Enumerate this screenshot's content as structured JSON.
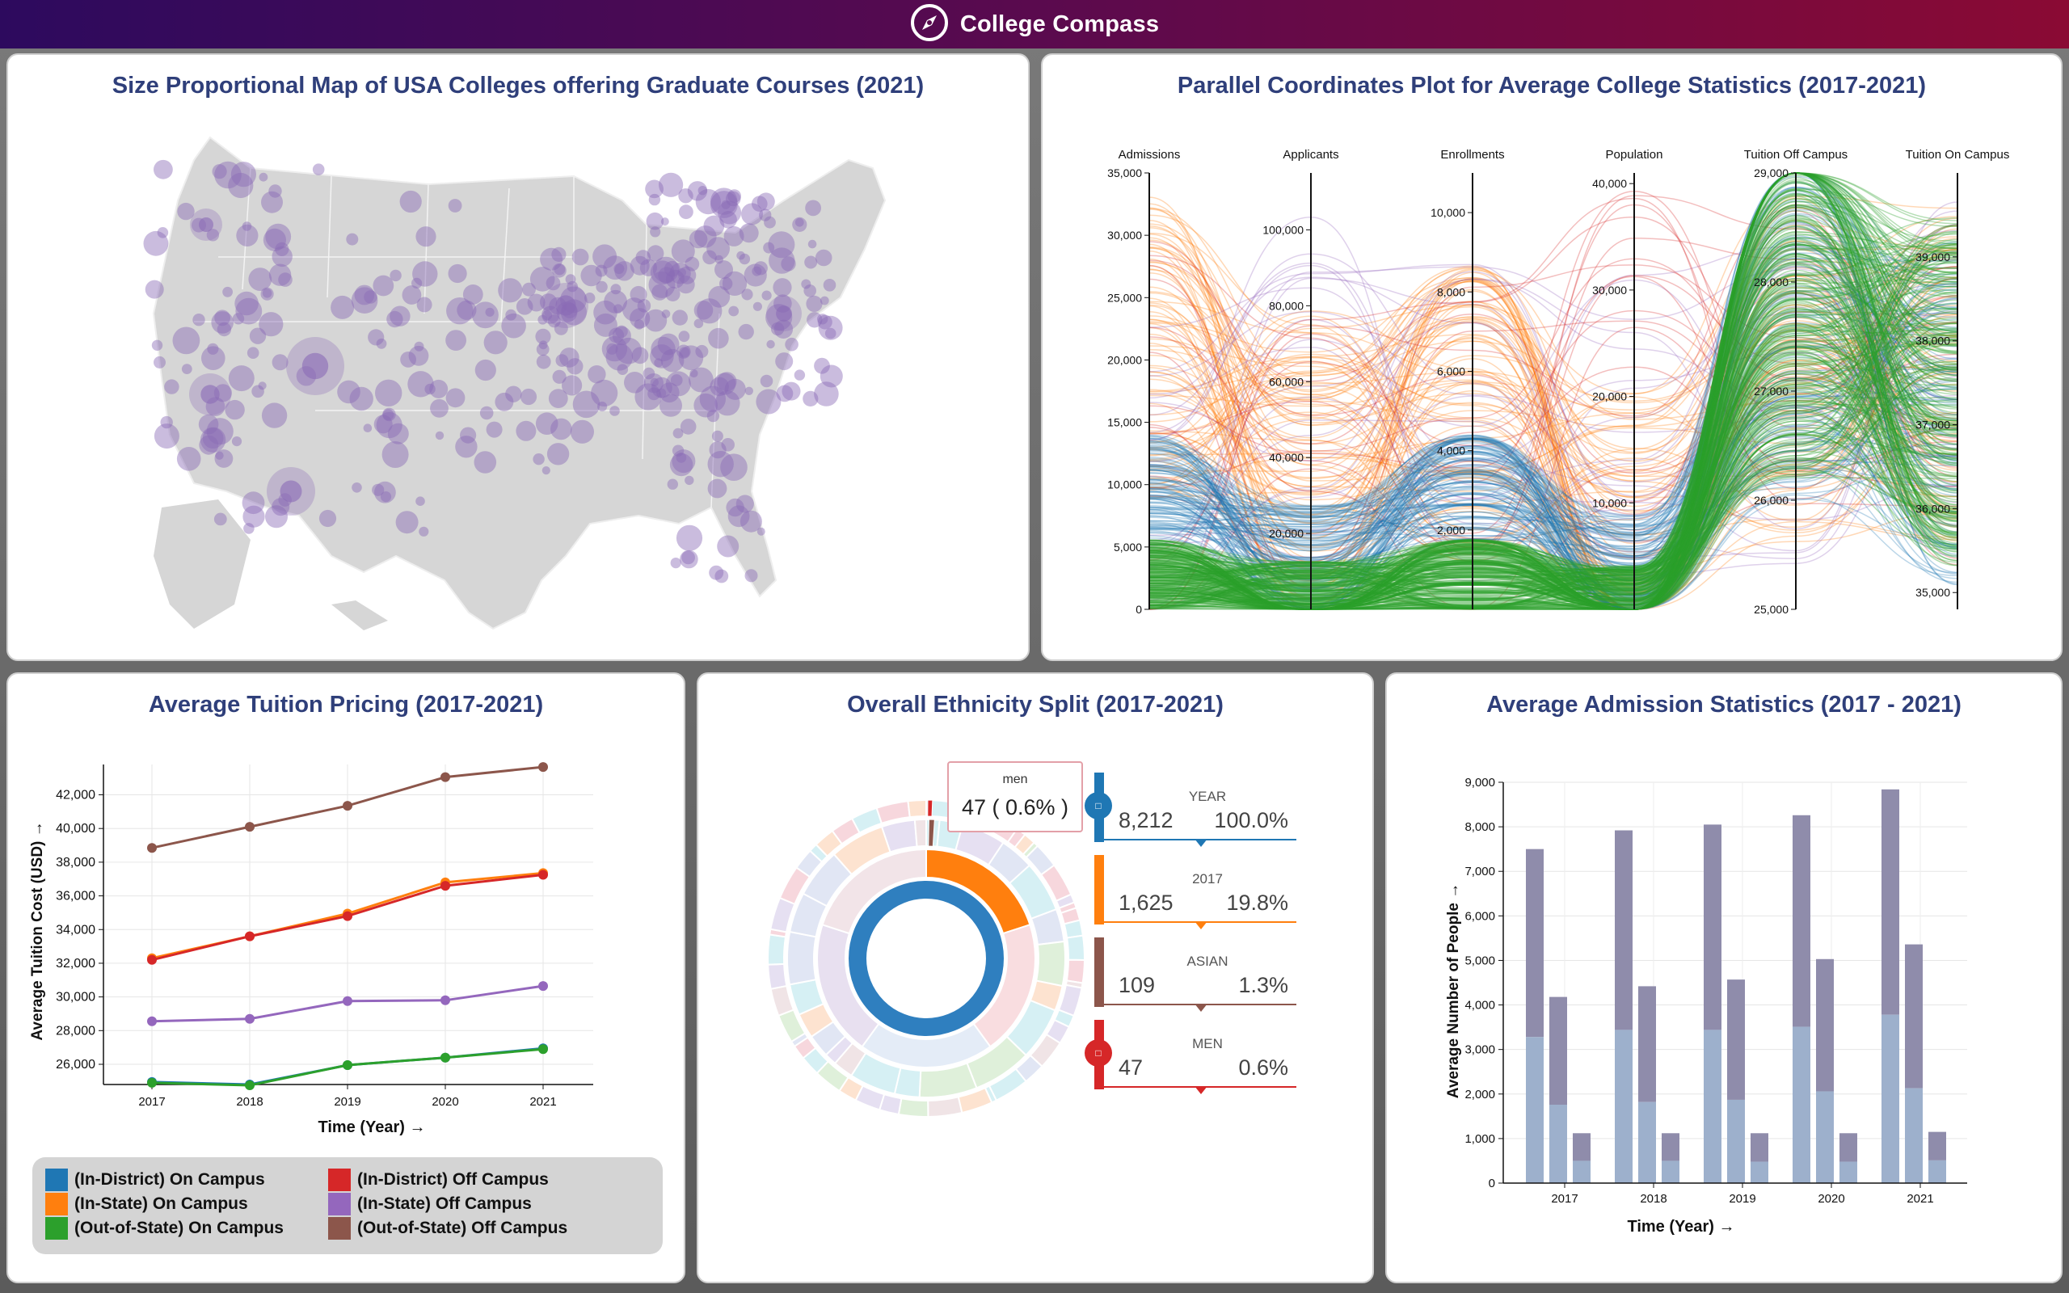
{
  "app": {
    "title": "College Compass",
    "logo_icon": "compass-icon"
  },
  "map_panel": {
    "title": "Size Proportional Map of USA Colleges offering Graduate Courses (2021)",
    "bubble_color": "#8a6bb5"
  },
  "parallel_panel": {
    "title": "Parallel Coordinates Plot for Average College Statistics (2017-2021)",
    "chart_data": {
      "type": "parallel-coordinates",
      "axes": [
        {
          "name": "Admissions",
          "ticks": [
            "0",
            "5,000",
            "10,000",
            "15,000",
            "20,000",
            "25,000",
            "30,000",
            "35,000"
          ],
          "range": [
            0,
            35000
          ]
        },
        {
          "name": "Applicants",
          "ticks": [
            "20,000",
            "40,000",
            "60,000",
            "80,000",
            "100,000"
          ],
          "range": [
            0,
            115000
          ]
        },
        {
          "name": "Enrollments",
          "ticks": [
            "2,000",
            "4,000",
            "6,000",
            "8,000",
            "10,000"
          ],
          "range": [
            0,
            11000
          ]
        },
        {
          "name": "Population",
          "ticks": [
            "10,000",
            "20,000",
            "30,000",
            "40,000"
          ],
          "range": [
            0,
            41000
          ]
        },
        {
          "name": "Tuition Off Campus",
          "ticks": [
            "25,000",
            "26,000",
            "27,000",
            "28,000",
            "29,000"
          ],
          "range": [
            25000,
            29000
          ]
        },
        {
          "name": "Tuition On Campus",
          "ticks": [
            "35,000",
            "36,000",
            "37,000",
            "38,000",
            "39,000"
          ],
          "range": [
            34800,
            40000
          ]
        }
      ],
      "line_colors": [
        "#ff7f0e",
        "#1f77b4",
        "#2ca02c",
        "#d62728",
        "#9467bd"
      ]
    }
  },
  "tuition_panel": {
    "title": "Average Tuition Pricing (2017-2021)",
    "chart_data": {
      "type": "line",
      "x": [
        "2017",
        "2018",
        "2019",
        "2020",
        "2021"
      ],
      "xlabel": "Time (Year) →",
      "ylabel": "Average Tuition Cost (USD) →",
      "ylim": [
        24800,
        43800
      ],
      "yticks": [
        26000,
        28000,
        30000,
        32000,
        34000,
        36000,
        38000,
        40000,
        42000
      ],
      "series": [
        {
          "name": "(Out-of-State) Off Campus",
          "color": "#8c564b",
          "values": [
            38850,
            40100,
            41350,
            43050,
            43650
          ]
        },
        {
          "name": "(In-State) On Campus",
          "color": "#ff7f0e",
          "values": [
            32300,
            33600,
            34950,
            36800,
            37350
          ]
        },
        {
          "name": "(In-District) Off Campus",
          "color": "#d62728",
          "values": [
            32200,
            33600,
            34800,
            36600,
            37250
          ]
        },
        {
          "name": "(In-State) Off Campus",
          "color": "#9467bd",
          "values": [
            28550,
            28700,
            29750,
            29800,
            30650
          ]
        },
        {
          "name": "(In-District) On Campus",
          "color": "#1f77b4",
          "values": [
            24950,
            24800,
            25950,
            26400,
            26950
          ]
        },
        {
          "name": "(Out-of-State) On Campus",
          "color": "#2ca02c",
          "values": [
            24900,
            24750,
            25950,
            26400,
            26900
          ]
        }
      ]
    },
    "legend": [
      {
        "label": "(In-District) On Campus",
        "color": "#1f77b4"
      },
      {
        "label": "(In-District) Off Campus",
        "color": "#d62728"
      },
      {
        "label": "(In-State) On Campus",
        "color": "#ff7f0e"
      },
      {
        "label": "(In-State) Off Campus",
        "color": "#9467bd"
      },
      {
        "label": "(Out-of-State) On Campus",
        "color": "#2ca02c"
      },
      {
        "label": "(Out-of-State) Off Campus",
        "color": "#8c564b"
      }
    ]
  },
  "ethnicity_panel": {
    "title": "Overall Ethnicity Split (2017-2021)",
    "tooltip": {
      "label": "men",
      "value": "47 ( 0.6% )"
    },
    "breadcrumbs": [
      {
        "label": "YEAR",
        "count": "8,212",
        "percent": "100.0%",
        "color": "#1f77b4"
      },
      {
        "label": "2017",
        "count": "1,625",
        "percent": "19.8%",
        "color": "#ff7f0e"
      },
      {
        "label": "ASIAN",
        "count": "109",
        "percent": "1.3%",
        "color": "#8c564b"
      },
      {
        "label": "MEN",
        "count": "47",
        "percent": "0.6%",
        "color": "#d62728"
      }
    ]
  },
  "admission_panel": {
    "title": "Average Admission Statistics (2017 - 2021)",
    "chart_data": {
      "type": "bar",
      "categories": [
        "2017",
        "2018",
        "2019",
        "2020",
        "2021"
      ],
      "xlabel": "Time (Year) →",
      "ylabel": "Average Number of People →",
      "ylim": [
        0,
        9000
      ],
      "yticks": [
        0,
        1000,
        2000,
        3000,
        4000,
        5000,
        6000,
        7000,
        8000,
        9000
      ],
      "bars": [
        [
          {
            "total": 7500,
            "base": 3280
          },
          {
            "total": 4180,
            "base": 1760
          },
          {
            "total": 1120,
            "base": 500
          }
        ],
        [
          {
            "total": 7920,
            "base": 3440
          },
          {
            "total": 4420,
            "base": 1820
          },
          {
            "total": 1120,
            "base": 500
          }
        ],
        [
          {
            "total": 8050,
            "base": 3440
          },
          {
            "total": 4570,
            "base": 1870
          },
          {
            "total": 1120,
            "base": 480
          }
        ],
        [
          {
            "total": 8260,
            "base": 3510
          },
          {
            "total": 5030,
            "base": 2060
          },
          {
            "total": 1120,
            "base": 480
          }
        ],
        [
          {
            "total": 8840,
            "base": 3780
          },
          {
            "total": 5360,
            "base": 2130
          },
          {
            "total": 1150,
            "base": 510
          }
        ]
      ],
      "colors": {
        "top": "#8f8cab",
        "base": "#9db0cc"
      }
    }
  }
}
